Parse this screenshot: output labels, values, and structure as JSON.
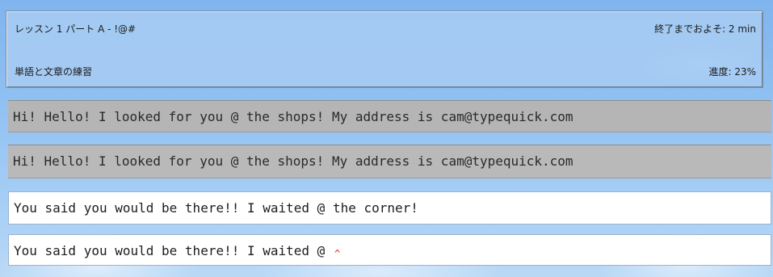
{
  "header": {
    "lesson_title": "レッスン 1 パート A - !@#",
    "time_remaining": "終了までおよそ: 2 min",
    "practice_label": "単語と文章の練習",
    "progress": "進度: 23%"
  },
  "lines": {
    "target_1": "Hi! Hello! I looked for you @ the shops! My address is cam@typequick.com",
    "typed_1": "Hi! Hello! I looked for you @ the shops! My address is cam@typequick.com",
    "target_2": "You said you would be there!! I waited @ the corner!",
    "typed_2": "You said you would be there!! I waited @ "
  },
  "markers": {
    "mistake": "x",
    "cursor": "^"
  },
  "colors": {
    "error_mark": "#e0201a",
    "header_panel": "#a6cbf3",
    "grey_box": "#b5b5b5"
  }
}
